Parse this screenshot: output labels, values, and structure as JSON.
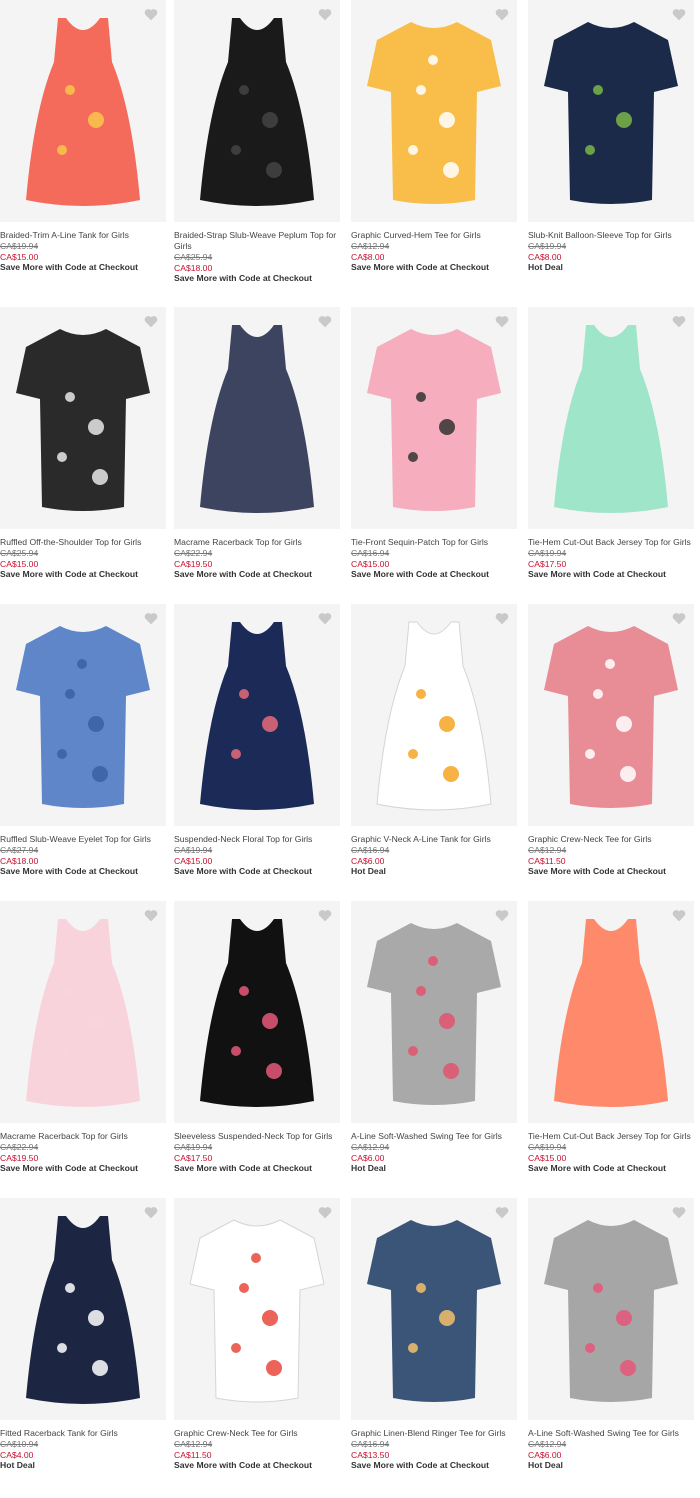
{
  "heart_color": "#c9c9c9",
  "price_color": "#c8102e",
  "products": [
    {
      "name": "Braided-Trim A-Line Tank for Girls",
      "was": "CA$19.94",
      "now": "CA$15.00",
      "promo": "Save More with Code at Checkout",
      "icon": "tank-top",
      "color": "#f46b5b",
      "pattern": "#f7c64b"
    },
    {
      "name": "Braided-Strap Slub-Weave Peplum Top for Girls",
      "was": "CA$25.94",
      "now": "CA$18.00",
      "promo": "Save More with Code at Checkout",
      "icon": "tank-top",
      "color": "#1a1a1a",
      "pattern": "#444444"
    },
    {
      "name": "Graphic Curved-Hem Tee for Girls",
      "was": "CA$12.94",
      "now": "CA$8.00",
      "promo": "Save More with Code at Checkout",
      "icon": "tee",
      "color": "#f9bd4a",
      "pattern": "#ffffff"
    },
    {
      "name": "Slub-Knit Balloon-Sleeve Top for Girls",
      "was": "CA$19.94",
      "now": "CA$8.00",
      "promo": "Hot Deal",
      "icon": "tee",
      "color": "#1b2a48",
      "pattern": "#7ab648"
    },
    {
      "name": "Ruffled Off-the-Shoulder Top for Girls",
      "was": "CA$25.94",
      "now": "CA$15.00",
      "promo": "Save More with Code at Checkout",
      "icon": "tee",
      "color": "#2a2a2a",
      "pattern": "#e8e8e8"
    },
    {
      "name": "Macrame Racerback Top for Girls",
      "was": "CA$22.94",
      "now": "CA$19.50",
      "promo": "Save More with Code at Checkout",
      "icon": "tank-top",
      "color": "#3d4460",
      "pattern": "#3d4460"
    },
    {
      "name": "Tie-Front Sequin-Patch Top for Girls",
      "was": "CA$16.94",
      "now": "CA$15.00",
      "promo": "Save More with Code at Checkout",
      "icon": "tee",
      "color": "#f6adbd",
      "pattern": "#333333"
    },
    {
      "name": "Tie-Hem Cut-Out Back Jersey Top for Girls",
      "was": "CA$19.94",
      "now": "CA$17.50",
      "promo": "Save More with Code at Checkout",
      "icon": "tank-top",
      "color": "#9fe5c9",
      "pattern": "#9fe5c9"
    },
    {
      "name": "Ruffled Slub-Weave Eyelet Top for Girls",
      "was": "CA$27.94",
      "now": "CA$18.00",
      "promo": "Save More with Code at Checkout",
      "icon": "tee",
      "color": "#5f86c9",
      "pattern": "#3a5fa5"
    },
    {
      "name": "Suspended-Neck Floral Top for Girls",
      "was": "CA$19.94",
      "now": "CA$15.00",
      "promo": "Save More with Code at Checkout",
      "icon": "tank-top",
      "color": "#1c2a57",
      "pattern": "#e86b7a"
    },
    {
      "name": "Graphic V-Neck A-Line Tank for Girls",
      "was": "CA$16.94",
      "now": "CA$6.00",
      "promo": "Hot Deal",
      "icon": "tank-top",
      "color": "#ffffff",
      "pattern": "#f5a623"
    },
    {
      "name": "Graphic Crew-Neck Tee for Girls",
      "was": "CA$12.94",
      "now": "CA$11.50",
      "promo": "Save More with Code at Checkout",
      "icon": "tee",
      "color": "#e88c95",
      "pattern": "#ffffff"
    },
    {
      "name": "Macrame Racerback Top for Girls",
      "was": "CA$22.94",
      "now": "CA$19.50",
      "promo": "Save More with Code at Checkout",
      "icon": "tank-top",
      "color": "#f9d3dc",
      "pattern": "#f9d3dc"
    },
    {
      "name": "Sleeveless Suspended-Neck Top for Girls",
      "was": "CA$19.94",
      "now": "CA$17.50",
      "promo": "Save More with Code at Checkout",
      "icon": "tank-top",
      "color": "#111111",
      "pattern": "#e8597a"
    },
    {
      "name": "A-Line Soft-Washed Swing Tee for Girls",
      "was": "CA$12.94",
      "now": "CA$6.00",
      "promo": "Hot Deal",
      "icon": "tee",
      "color": "#a9a9a9",
      "pattern": "#e2536e"
    },
    {
      "name": "Tie-Hem Cut-Out Back Jersey Top for Girls",
      "was": "CA$19.94",
      "now": "CA$15.00",
      "promo": "Save More with Code at Checkout",
      "icon": "tank-top",
      "color": "#ff8a6b",
      "pattern": "#ff8a6b"
    },
    {
      "name": "Fitted Racerback Tank for Girls",
      "was": "CA$10.94",
      "now": "CA$4.00",
      "promo": "Hot Deal",
      "icon": "tank-top",
      "color": "#1c2642",
      "pattern": "#ffffff"
    },
    {
      "name": "Graphic Crew-Neck Tee for Girls",
      "was": "CA$12.94",
      "now": "CA$11.50",
      "promo": "Save More with Code at Checkout",
      "icon": "tee",
      "color": "#ffffff",
      "pattern": "#e8483c"
    },
    {
      "name": "Graphic Linen-Blend Ringer Tee for Girls",
      "was": "CA$16.94",
      "now": "CA$13.50",
      "promo": "Save More with Code at Checkout",
      "icon": "tee",
      "color": "#3b5579",
      "pattern": "#f5c16c"
    },
    {
      "name": "A-Line Soft-Washed Swing Tee for Girls",
      "was": "CA$12.94",
      "now": "CA$6.00",
      "promo": "Hot Deal",
      "icon": "tee",
      "color": "#a6a6a6",
      "pattern": "#e6557a"
    }
  ]
}
